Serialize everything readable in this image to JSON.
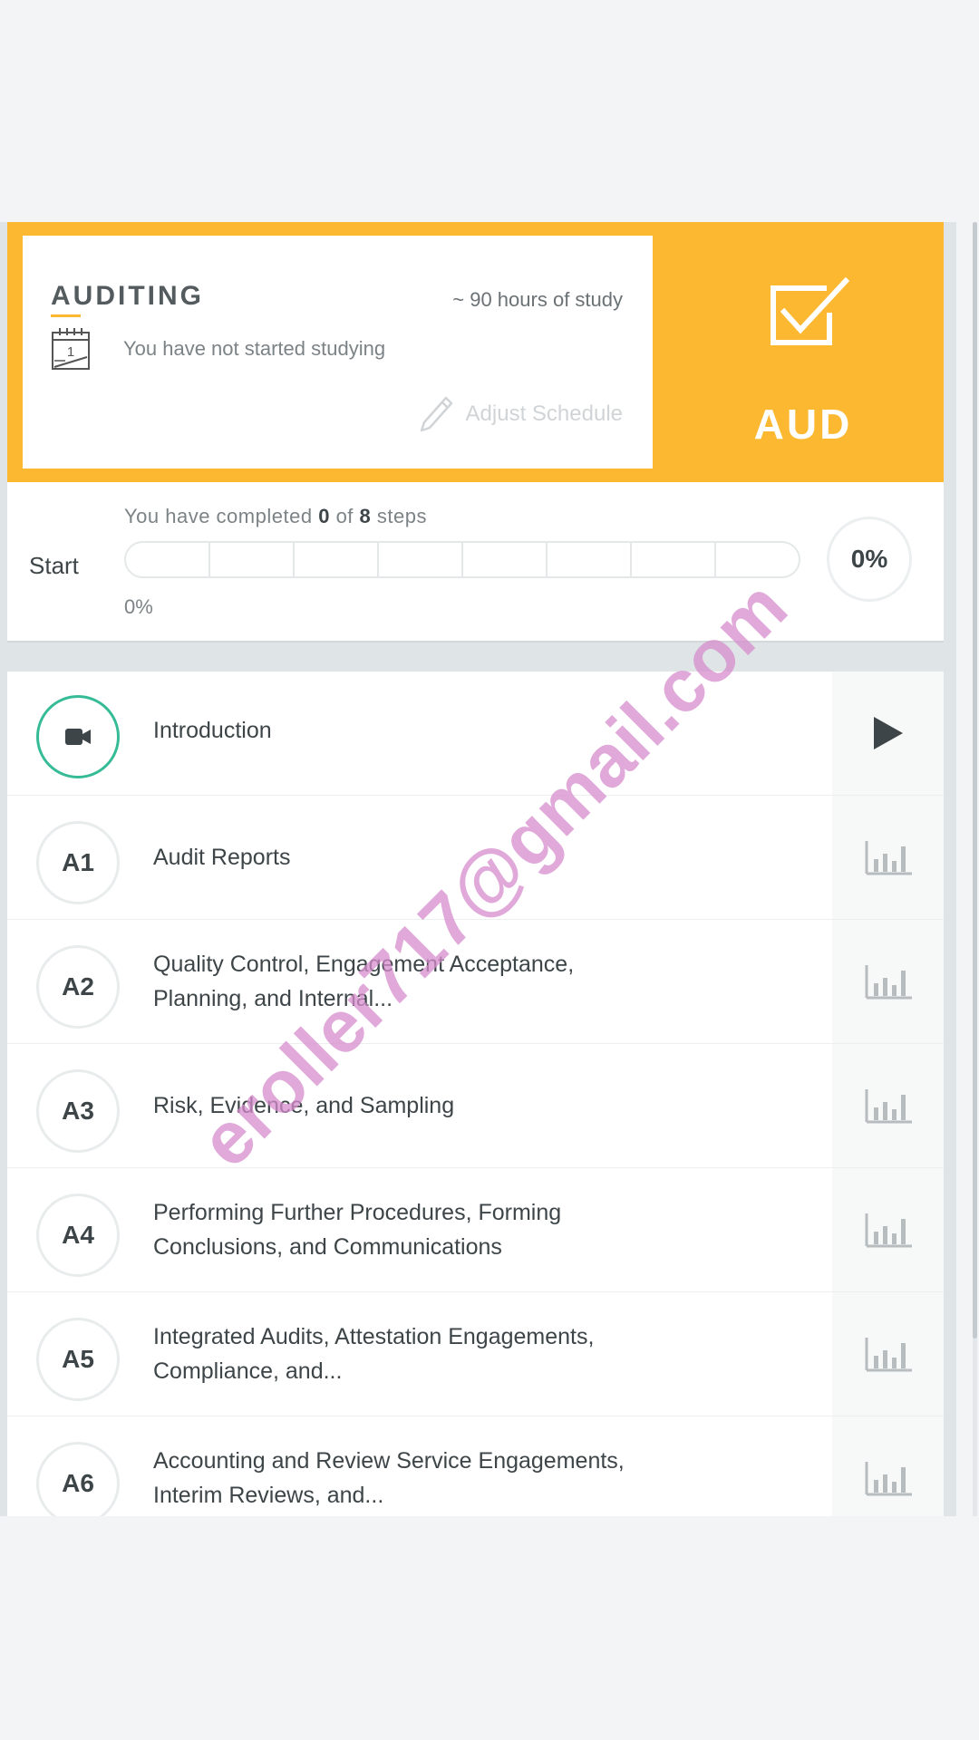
{
  "subject": {
    "title": "AUDITING",
    "hours": "~ 90 hours of study",
    "status": "You have not started studying",
    "adjust_schedule": "Adjust Schedule",
    "code": "AUD",
    "accent_color": "#fbb830"
  },
  "progress": {
    "start_label": "Start",
    "prefix": "You have completed",
    "completed": "0",
    "of": "of",
    "total": "8",
    "suffix": "steps",
    "bar_percent": "0%",
    "fraction": 0,
    "circle_percent": "0%"
  },
  "lessons": [
    {
      "badge_icon": "video-camera-icon",
      "title": "Introduction",
      "action_icon": "play-icon",
      "ring_color": "#35bc97"
    },
    {
      "badge": "A1",
      "title": "Audit Reports",
      "action_icon": "bar-chart-icon"
    },
    {
      "badge": "A2",
      "title": "Quality Control, Engagement Acceptance, Planning, and Internal...",
      "action_icon": "bar-chart-icon"
    },
    {
      "badge": "A3",
      "title": "Risk, Evidence, and Sampling",
      "action_icon": "bar-chart-icon"
    },
    {
      "badge": "A4",
      "title": "Performing Further Procedures, Forming Conclusions, and Communications",
      "action_icon": "bar-chart-icon"
    },
    {
      "badge": "A5",
      "title": "Integrated Audits, Attestation Engagements, Compliance, and...",
      "action_icon": "bar-chart-icon"
    },
    {
      "badge": "A6",
      "title": "Accounting and Review Service Engagements, Interim Reviews, and...",
      "action_icon": "bar-chart-icon"
    }
  ],
  "watermark": "eroller717@gmail.com"
}
